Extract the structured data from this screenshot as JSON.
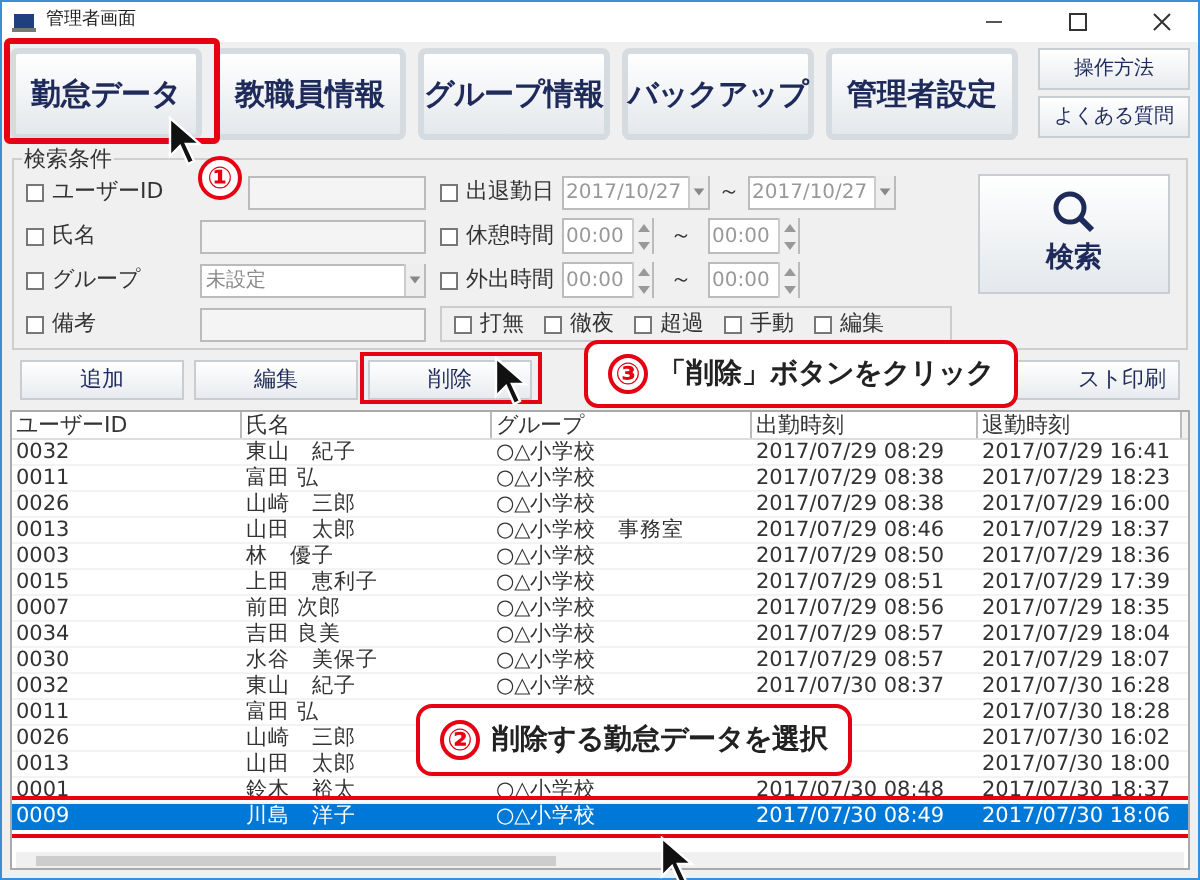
{
  "window": {
    "title": "管理者画面"
  },
  "nav_buttons": [
    "勤怠データ",
    "教職員情報",
    "グループ情報",
    "バックアップ",
    "管理者設定"
  ],
  "help_buttons": [
    "操作方法",
    "よくある質問"
  ],
  "search": {
    "title": "検索条件",
    "fields": [
      {
        "kind": "text",
        "label": "ユーザーID",
        "checked": false
      },
      {
        "kind": "text",
        "label": "氏名",
        "checked": false
      },
      {
        "kind": "select",
        "label": "グループ",
        "checked": false,
        "value": "未設定"
      },
      {
        "kind": "text",
        "label": "備考",
        "checked": false
      }
    ],
    "ranges": [
      {
        "kind": "date",
        "label": "出退勤日",
        "checked": false,
        "from": "2017/10/27",
        "sep": "～",
        "to": "2017/10/27"
      },
      {
        "kind": "time",
        "label": "休憩時間",
        "checked": false,
        "from": "00:00",
        "sep": "～",
        "to": "00:00"
      },
      {
        "kind": "time",
        "label": "外出時間",
        "checked": false,
        "from": "00:00",
        "sep": "～",
        "to": "00:00"
      }
    ],
    "flags": [
      {
        "label": "打無",
        "checked": false
      },
      {
        "label": "徹夜",
        "checked": false
      },
      {
        "label": "超過",
        "checked": false
      },
      {
        "label": "手動",
        "checked": false
      },
      {
        "label": "編集",
        "checked": false
      }
    ],
    "search_button": "検索"
  },
  "actions": [
    "追加",
    "編集",
    "削除",
    "スト印刷"
  ],
  "table": {
    "columns": [
      "ユーザーID",
      "氏名",
      "グループ",
      "出勤時刻",
      "退勤時刻"
    ],
    "rows": [
      {
        "selected": false,
        "cells": [
          "0032",
          "東山　紀子",
          "○△小学校",
          "2017/07/29 08:29",
          "2017/07/29 16:41"
        ]
      },
      {
        "selected": false,
        "cells": [
          "0011",
          "富田 弘",
          "○△小学校",
          "2017/07/29 08:38",
          "2017/07/29 18:23"
        ]
      },
      {
        "selected": false,
        "cells": [
          "0026",
          "山崎　三郎",
          "○△小学校",
          "2017/07/29 08:38",
          "2017/07/29 16:00"
        ]
      },
      {
        "selected": false,
        "cells": [
          "0013",
          "山田　太郎",
          "○△小学校　事務室",
          "2017/07/29 08:46",
          "2017/07/29 18:37"
        ]
      },
      {
        "selected": false,
        "cells": [
          "0003",
          "林　優子",
          "○△小学校",
          "2017/07/29 08:50",
          "2017/07/29 18:36"
        ]
      },
      {
        "selected": false,
        "cells": [
          "0015",
          "上田　恵利子",
          "○△小学校",
          "2017/07/29 08:51",
          "2017/07/29 17:39"
        ]
      },
      {
        "selected": false,
        "cells": [
          "0007",
          "前田 次郎",
          "○△小学校",
          "2017/07/29 08:56",
          "2017/07/29 18:35"
        ]
      },
      {
        "selected": false,
        "cells": [
          "0034",
          "吉田 良美",
          "○△小学校",
          "2017/07/29 08:57",
          "2017/07/29 18:04"
        ]
      },
      {
        "selected": false,
        "cells": [
          "0030",
          "水谷　美保子",
          "○△小学校",
          "2017/07/29 08:57",
          "2017/07/29 18:07"
        ]
      },
      {
        "selected": false,
        "cells": [
          "0032",
          "東山　紀子",
          "○△小学校",
          "2017/07/30 08:37",
          "2017/07/30 16:28"
        ]
      },
      {
        "selected": false,
        "cells": [
          "0011",
          "富田 弘",
          null,
          null,
          "2017/07/30 18:28"
        ]
      },
      {
        "selected": false,
        "cells": [
          "0026",
          "山崎　三郎",
          null,
          null,
          "2017/07/30 16:02"
        ]
      },
      {
        "selected": false,
        "cells": [
          "0013",
          "山田　太郎",
          null,
          null,
          "2017/07/30 18:00"
        ]
      },
      {
        "selected": false,
        "cells": [
          "0001",
          "鈴木　裕太",
          "○△小学校",
          "2017/07/30 08:48",
          "2017/07/30 18:37"
        ]
      },
      {
        "selected": true,
        "cells": [
          "0009",
          "川島　洋子",
          "○△小学校",
          "2017/07/30 08:49",
          "2017/07/30 18:06"
        ]
      }
    ]
  },
  "callouts": [
    {
      "number": "①"
    },
    {
      "number": "③",
      "text": "「削除」ボタンをクリック"
    },
    {
      "number": "②",
      "text": "削除する勤怠データを選択"
    }
  ]
}
